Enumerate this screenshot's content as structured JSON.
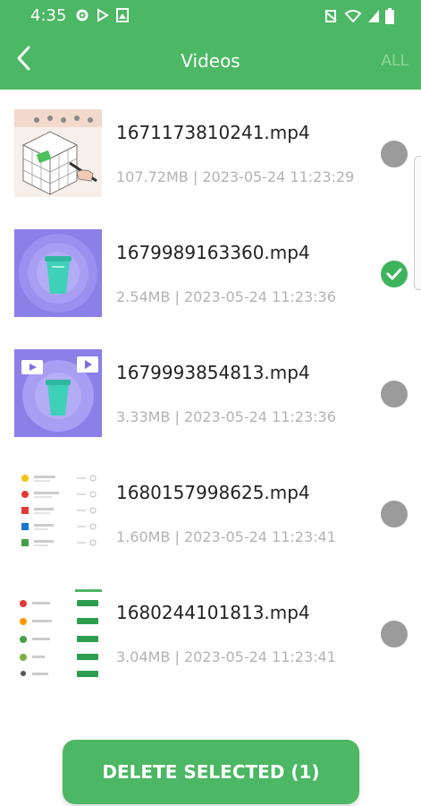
{
  "status": {
    "time": "4:35",
    "left_icons": [
      "gear-icon",
      "play-icon",
      "image-icon"
    ],
    "right_icons": [
      "nfc-mute-icon",
      "wifi-icon",
      "signal-icon",
      "battery-icon"
    ]
  },
  "appbar": {
    "title": "Videos",
    "all_label": "ALL",
    "back_icon": "chevron-left-icon"
  },
  "colors": {
    "primary": "#4cb764",
    "check": "#3db35b",
    "radio_off": "#9b9b9b"
  },
  "videos": [
    {
      "name": "1671173810241.mp4",
      "meta": "107.72MB | 2023-05-24 11:23:29",
      "selected": false,
      "thumb": "isometric-blocks-drawing"
    },
    {
      "name": "1679989163360.mp4",
      "meta": "2.54MB | 2023-05-24 11:23:36",
      "selected": true,
      "thumb": "purple-trash-bin"
    },
    {
      "name": "1679993854813.mp4",
      "meta": "3.33MB | 2023-05-24 11:23:36",
      "selected": false,
      "thumb": "purple-trash-bin-video"
    },
    {
      "name": "1680157998625.mp4",
      "meta": "1.60MB | 2023-05-24 11:23:41",
      "selected": false,
      "thumb": "app-list-screenshot"
    },
    {
      "name": "1680244101813.mp4",
      "meta": "3.04MB | 2023-05-24 11:23:41",
      "selected": false,
      "thumb": "app-list-screenshot-2"
    }
  ],
  "footer": {
    "delete_label": "DELETE SELECTED (1)"
  }
}
